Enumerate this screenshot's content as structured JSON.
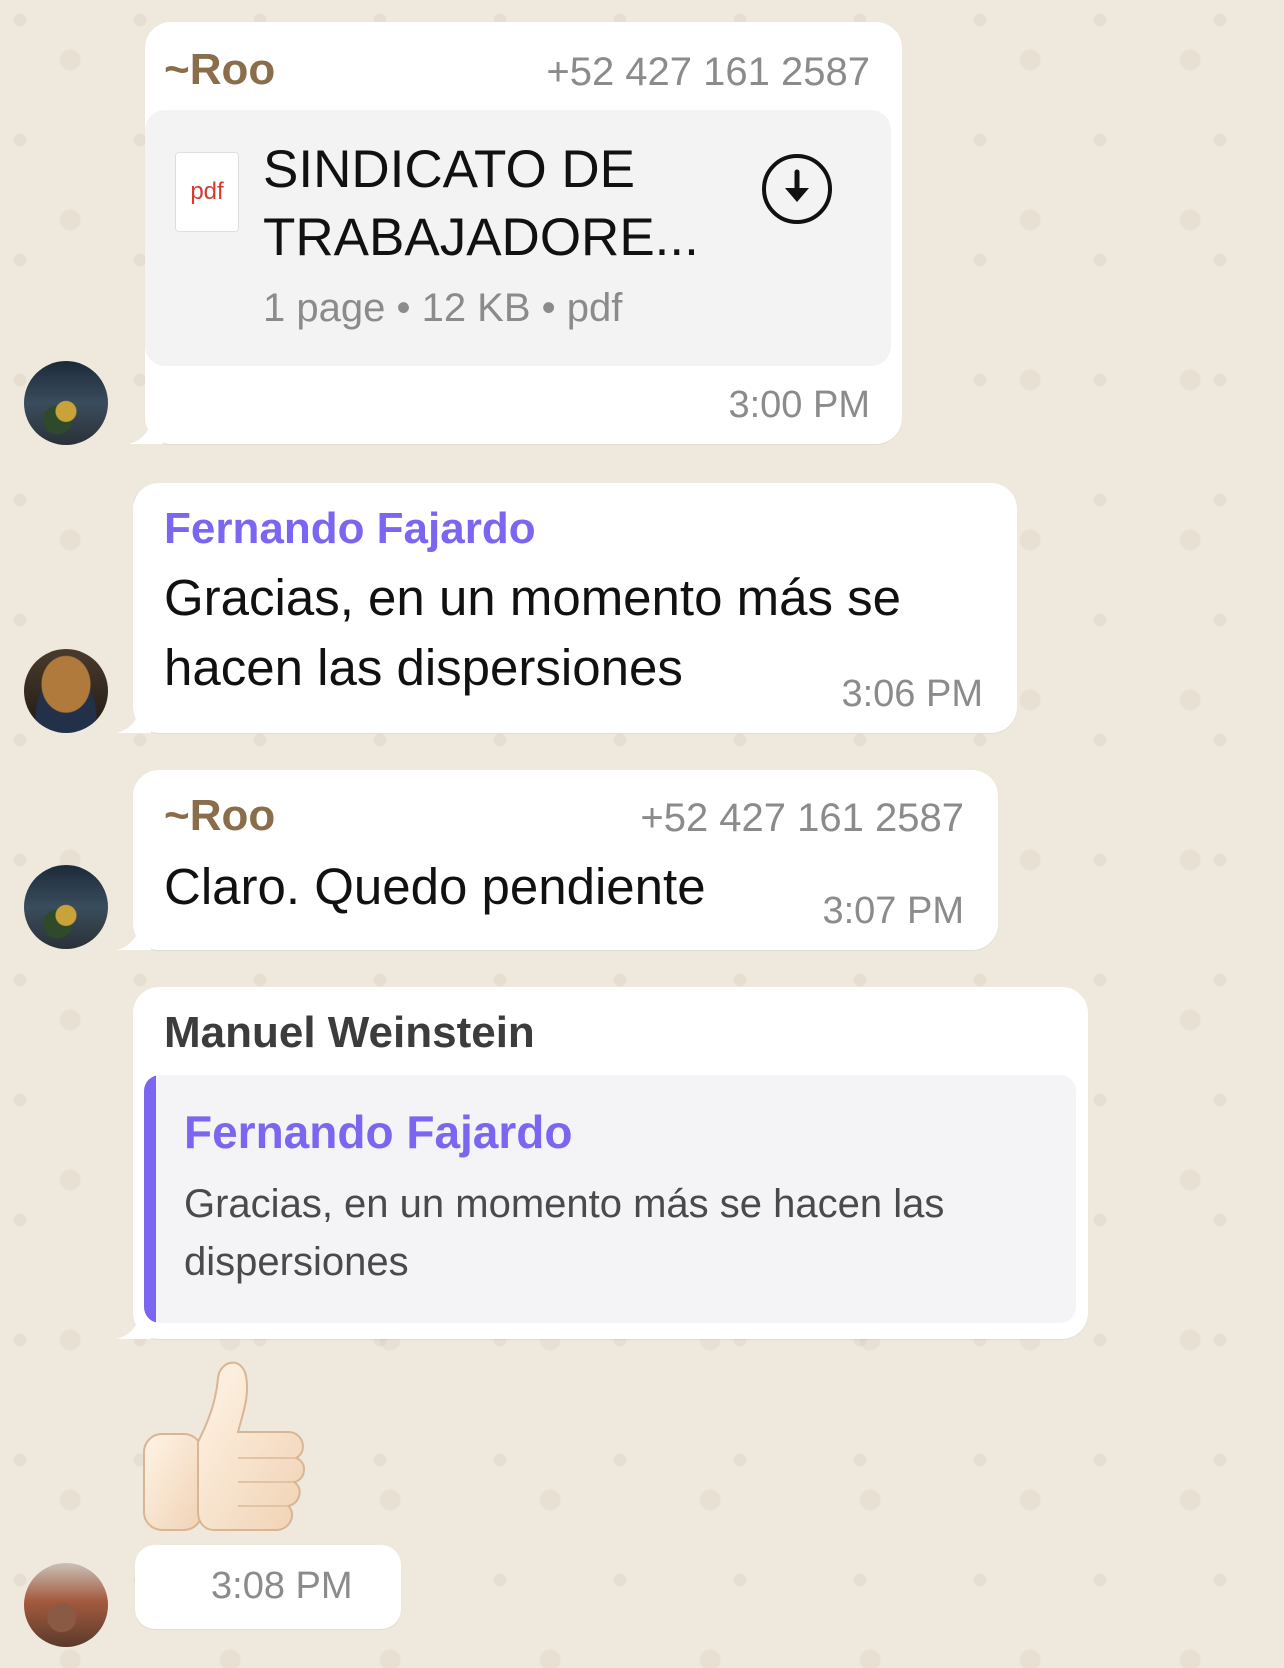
{
  "messages": [
    {
      "sender": "~Roo",
      "phone": "+52 427 161 2587",
      "document": {
        "type_label": "pdf",
        "title_line1": "SINDICATO DE",
        "title_line2": "TRABAJADORE...",
        "meta": "1 page • 12 KB • pdf",
        "icon": "download-icon"
      },
      "time": "3:00 PM"
    },
    {
      "sender": "Fernando Fajardo",
      "line1": "Gracias, en un momento más se",
      "line2": "hacen las dispersiones",
      "time": "3:06 PM"
    },
    {
      "sender": "~Roo",
      "phone": "+52 427 161 2587",
      "text": "Claro. Quedo pendiente",
      "time": "3:07 PM"
    },
    {
      "sender": "Manuel Weinstein",
      "quote": {
        "sender": "Fernando Fajardo",
        "line1": "Gracias, en un momento más se hacen las",
        "line2": "dispersiones"
      }
    },
    {
      "emoji": "thumbs-up",
      "time": "3:08 PM"
    }
  ],
  "colors": {
    "background": "#efe9dd",
    "bubble": "#ffffff",
    "roo_name": "#8a6e4c",
    "fernando_name": "#7a66f0",
    "manuel_name": "#3c3c3c",
    "timestamp": "#8b8b8b"
  }
}
